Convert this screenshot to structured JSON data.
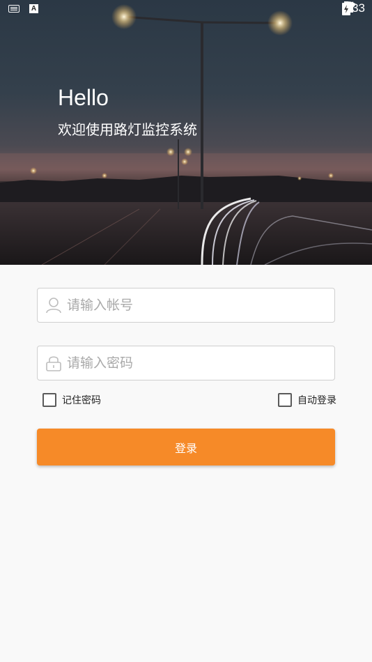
{
  "status_bar": {
    "time": "8:33",
    "a_indicator": "A"
  },
  "hero": {
    "greeting": "Hello",
    "subtitle": "欢迎使用路灯监控系统"
  },
  "login_form": {
    "account_placeholder": "请输入帐号",
    "password_placeholder": "请输入密码",
    "remember_password": "记住密码",
    "auto_login": "自动登录",
    "login_button": "登录"
  },
  "colors": {
    "accent": "#f68a28",
    "background": "#f9f9f9"
  },
  "icons": [
    "keyboard-icon",
    "a-notification-icon",
    "wifi-icon",
    "signal-icon",
    "battery-icon",
    "user-icon",
    "lock-icon"
  ]
}
